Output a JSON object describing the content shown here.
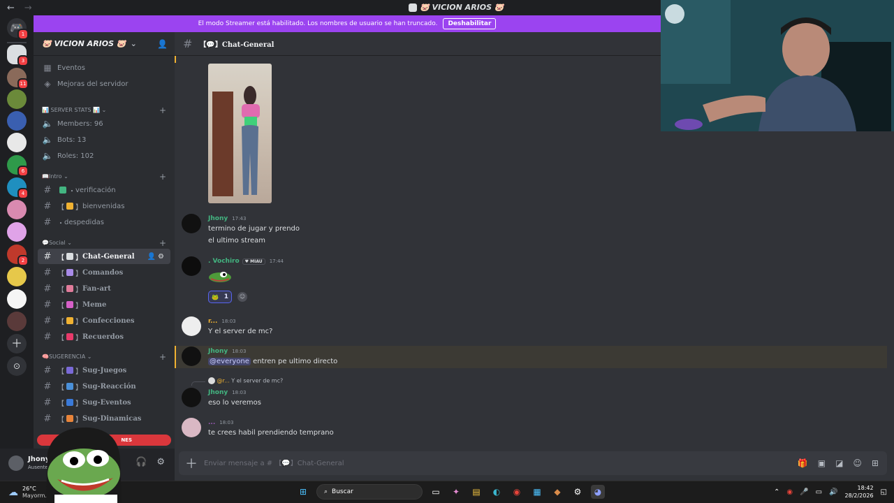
{
  "window": {
    "title": "🐷 VICION ARIOS 🐷"
  },
  "banner": {
    "text": "El modo Streamer está habilitado. Los nombres de usuario se han truncado.",
    "button": "Deshabilitar"
  },
  "rail": {
    "badges": [
      "1",
      "3",
      "11",
      "6",
      "4",
      "2"
    ]
  },
  "server": {
    "name": "🐷 VICION ARIOS 🐷"
  },
  "sidebar": {
    "top_items": [
      {
        "label": "Eventos",
        "icon": "calendar-icon"
      },
      {
        "label": "Mejoras del servidor",
        "icon": "boost-icon"
      }
    ],
    "categories": [
      {
        "label": "📊 SERVER STATS 📊",
        "channels": [
          "Members: 96",
          "Bots: 13",
          "Roles: 102"
        ]
      },
      {
        "label": "📖Intro",
        "channels": [
          "verificación",
          "bienvenidas",
          "despedidas"
        ]
      },
      {
        "label": "💬Social",
        "channels": [
          "Chat-General",
          "Comandos",
          "Fan-art",
          "Meme",
          "Confecciones",
          "Recuerdos"
        ]
      },
      {
        "label": "🧠SUGERENCIA",
        "channels": [
          "Sug-Juegos",
          "Sug-Reacción",
          "Sug-Eventos",
          "Sug-Dinamicas"
        ]
      }
    ],
    "red_pill": "NES"
  },
  "user": {
    "name": "Jhony",
    "status": "Ausente"
  },
  "channel": {
    "name": "Chat-General"
  },
  "messages": [
    {
      "author": "Jhony",
      "time": "17:43",
      "lines": [
        "termino de jugar y prendo",
        "el ultimo stream"
      ],
      "color": "#43b581"
    },
    {
      "author": ". Vochiro",
      "tag": "MIAU",
      "time": "17:44",
      "reaction_count": "1",
      "color": "#43b581"
    },
    {
      "author": "r...",
      "time": "18:03",
      "lines": [
        "Y el server de mc?"
      ],
      "color": "#f0b232"
    },
    {
      "author": "Jhony",
      "time": "18:03",
      "mention": "@everyone",
      "lines": [
        "entren pe ultimo directo"
      ],
      "color": "#43b581"
    },
    {
      "reply_author": "@r...",
      "reply_text": "Y el server de mc?"
    },
    {
      "author": "Jhony",
      "time": "18:03",
      "lines": [
        "eso lo veremos"
      ],
      "color": "#43b581"
    },
    {
      "author": "...",
      "time": "18:03",
      "lines": [
        "te crees habil prendiendo temprano"
      ],
      "color": "#9b59b6"
    }
  ],
  "composer": {
    "placeholder": "Enviar mensaje a # 【💬】Chat-General"
  },
  "taskbar": {
    "weather_temp": "26°C",
    "weather_desc": "Mayorm...",
    "search_label": "Buscar",
    "time": "18:42",
    "date": "28/2/2026"
  },
  "colors": {
    "banner": "#9b44f0",
    "accent": "#5865f2",
    "online_green": "#43b581",
    "mention_red": "#f23f43"
  }
}
